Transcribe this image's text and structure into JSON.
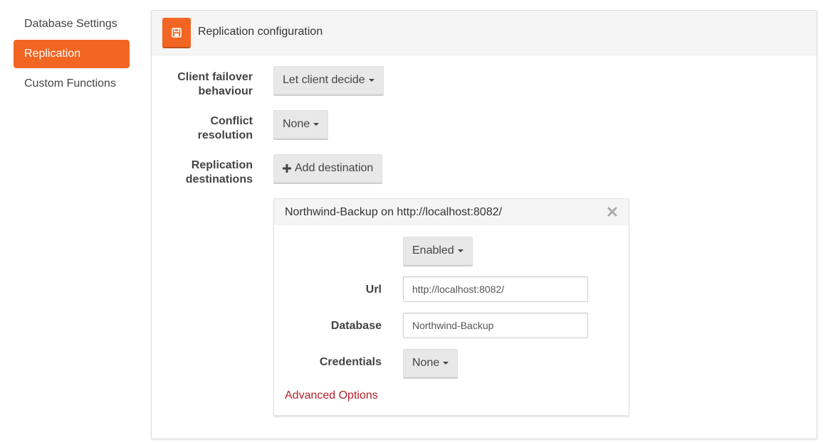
{
  "sidebar": {
    "items": [
      {
        "label": "Database Settings"
      },
      {
        "label": "Replication"
      },
      {
        "label": "Custom Functions"
      }
    ],
    "active_index": 1
  },
  "panel": {
    "title": "Replication configuration",
    "save_icon": "floppy-disk-icon"
  },
  "form": {
    "failover_label_1": "Client failover",
    "failover_label_2": "behaviour",
    "failover_value": "Let client decide",
    "conflict_label_1": "Conflict",
    "conflict_label_2": "resolution",
    "conflict_value": "None",
    "destinations_label_1": "Replication",
    "destinations_label_2": "destinations",
    "add_destination_label": "Add destination"
  },
  "destination": {
    "title": "Northwind-Backup on http://localhost:8082/",
    "status_value": "Enabled",
    "url_label": "Url",
    "url_value": "http://localhost:8082/",
    "database_label": "Database",
    "database_value": "Northwind-Backup",
    "credentials_label": "Credentials",
    "credentials_value": "None",
    "advanced_options_label": "Advanced Options"
  },
  "colors": {
    "accent": "#f26522",
    "link": "#b2222a"
  }
}
